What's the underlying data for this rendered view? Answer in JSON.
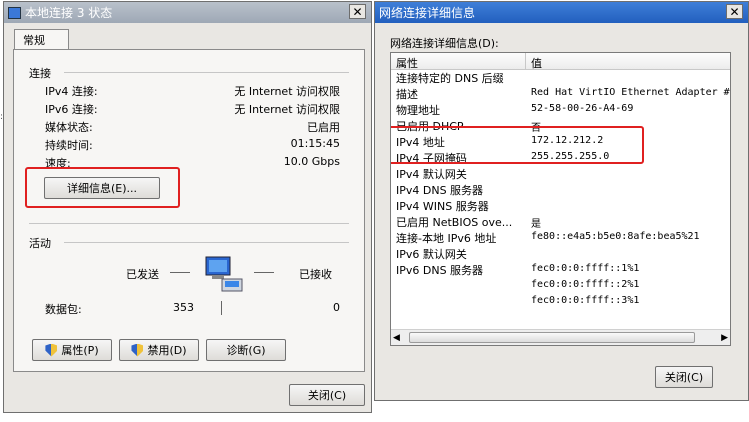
{
  "status_window": {
    "title": "本地连接 3 状态",
    "tab": "常规",
    "connection_group": "连接",
    "rows": [
      {
        "label": "IPv4 连接:",
        "value": "无 Internet 访问权限"
      },
      {
        "label": "IPv6 连接:",
        "value": "无 Internet 访问权限"
      },
      {
        "label": "媒体状态:",
        "value": "已启用"
      },
      {
        "label": "持续时间:",
        "value": "01:15:45"
      },
      {
        "label": "速度:",
        "value": "10.0 Gbps"
      }
    ],
    "details_button": "详细信息(E)...",
    "activity_group": "活动",
    "sent_label": "已发送",
    "received_label": "已接收",
    "packets_label": "数据包:",
    "packets_sent": "353",
    "packets_received": "0",
    "properties_button": "属性(P)",
    "disable_button": "禁用(D)",
    "diagnose_button": "诊断(G)",
    "close_button": "关闭(C)"
  },
  "details_window": {
    "title": "网络连接详细信息",
    "list_label": "网络连接详细信息(D):",
    "col_property": "属性",
    "col_value": "值",
    "rows": [
      {
        "property": "连接特定的 DNS 后缀",
        "value": ""
      },
      {
        "property": "描述",
        "value": "Red Hat VirtIO Ethernet Adapter #"
      },
      {
        "property": "物理地址",
        "value": "52-58-00-26-A4-69"
      },
      {
        "property": "已启用 DHCP",
        "value": "否"
      },
      {
        "property": "IPv4 地址",
        "value": "172.12.212.2"
      },
      {
        "property": "IPv4 子网掩码",
        "value": "255.255.255.0"
      },
      {
        "property": "IPv4 默认网关",
        "value": ""
      },
      {
        "property": "IPv4 DNS 服务器",
        "value": ""
      },
      {
        "property": "IPv4 WINS 服务器",
        "value": ""
      },
      {
        "property": "已启用 NetBIOS ove...",
        "value": "是"
      },
      {
        "property": "连接-本地 IPv6 地址",
        "value": "fe80::e4a5:b5e0:8afe:bea5%21"
      },
      {
        "property": "IPv6 默认网关",
        "value": ""
      },
      {
        "property": "IPv6 DNS 服务器",
        "value": "fec0:0:0:ffff::1%1"
      },
      {
        "property": "",
        "value": "fec0:0:0:ffff::2%1"
      },
      {
        "property": "",
        "value": "fec0:0:0:ffff::3%1"
      }
    ],
    "close_button": "关闭(C)"
  },
  "colors": {
    "titlebar_inactive": "#aeb6c0",
    "titlebar_active": "#2e6cc4",
    "highlight_box": "#e02020"
  }
}
